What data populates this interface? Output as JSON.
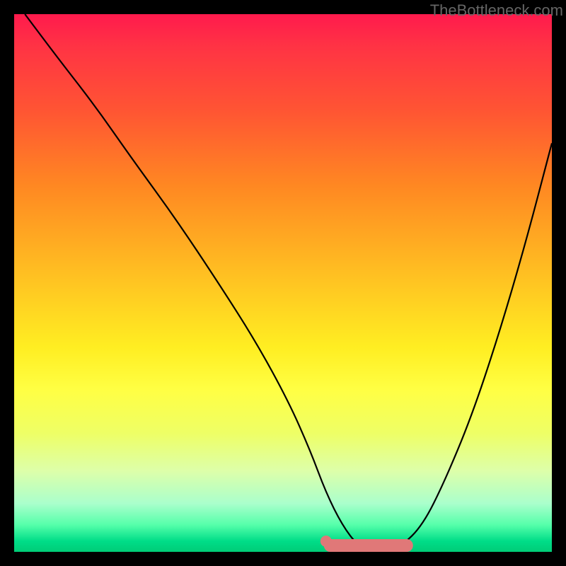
{
  "watermark": "TheBottleneck.com",
  "chart_data": {
    "type": "line",
    "title": "",
    "xlabel": "",
    "ylabel": "",
    "xlim": [
      0,
      100
    ],
    "ylim": [
      0,
      100
    ],
    "series": [
      {
        "name": "bottleneck-curve",
        "x": [
          2,
          8,
          15,
          22,
          30,
          38,
          45,
          51,
          55,
          58,
          61,
          64,
          68,
          72,
          76,
          80,
          85,
          90,
          95,
          100
        ],
        "y": [
          100,
          92,
          83,
          73,
          62,
          50,
          39,
          28,
          19,
          11,
          5,
          1,
          0,
          1,
          5,
          13,
          25,
          40,
          57,
          76
        ]
      }
    ],
    "marker": {
      "name": "optimal-range",
      "x_start": 58,
      "x_end": 73,
      "y": 0
    },
    "gradient_colors": [
      "#ff1a4d",
      "#ffaa22",
      "#ffff44",
      "#00cc77"
    ]
  }
}
